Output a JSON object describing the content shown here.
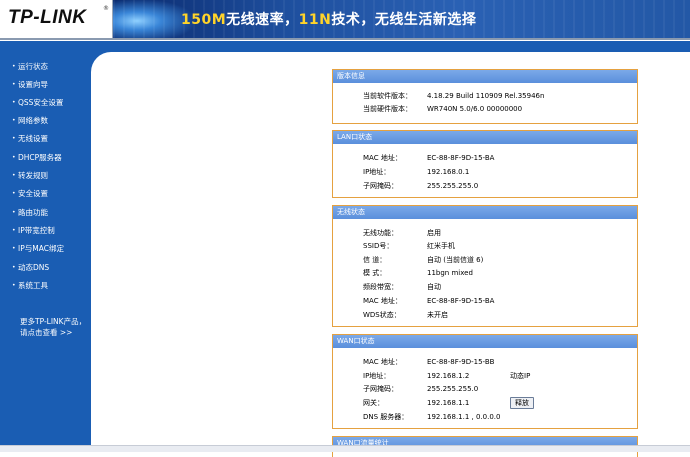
{
  "header": {
    "logo": "TP-LINK",
    "logo_mark": "®",
    "banner_prefix": "150M",
    "banner_mid1": "无线速率，",
    "banner_hl2": "11N",
    "banner_mid2": "技术，无线生活新选择"
  },
  "sidebar": {
    "items": [
      {
        "label": "运行状态"
      },
      {
        "label": "设置向导"
      },
      {
        "label": "QSS安全设置"
      },
      {
        "label": "网络参数"
      },
      {
        "label": "无线设置"
      },
      {
        "label": "DHCP服务器"
      },
      {
        "label": "转发规则"
      },
      {
        "label": "安全设置"
      },
      {
        "label": "路由功能"
      },
      {
        "label": "IP带宽控制"
      },
      {
        "label": "IP与MAC绑定"
      },
      {
        "label": "动态DNS"
      },
      {
        "label": "系统工具"
      }
    ],
    "bullet": "•",
    "more_line1": "更多TP-LINK产品，",
    "more_line2": "请点击查看 >>"
  },
  "version_panel": {
    "title": "版本信息",
    "rows": [
      {
        "label": "当前软件版本：",
        "value": "4.18.29 Build 110909 Rel.35946n"
      },
      {
        "label": "当前硬件版本：",
        "value": "WR740N 5.0/6.0 00000000"
      }
    ]
  },
  "lan_panel": {
    "title": "LAN口状态",
    "rows": [
      {
        "label": "MAC 地址：",
        "value": "EC-88-8F-9D-15-BA"
      },
      {
        "label": "IP地址：",
        "value": "192.168.0.1"
      },
      {
        "label": "子网掩码：",
        "value": "255.255.255.0"
      }
    ]
  },
  "wireless_panel": {
    "title": "无线状态",
    "rows": [
      {
        "label": "无线功能：",
        "value": "启用"
      },
      {
        "label": "SSID号：",
        "value": "红米手机"
      },
      {
        "label": "信 道：",
        "value": "自动 (当前信道 6)"
      },
      {
        "label": "模 式：",
        "value": "11bgn mixed"
      },
      {
        "label": "频段带宽：",
        "value": "自动"
      },
      {
        "label": "MAC 地址：",
        "value": "EC-88-8F-9D-15-BA"
      },
      {
        "label": "WDS状态：",
        "value": "未开启"
      }
    ]
  },
  "wan_panel": {
    "title": "WAN口状态",
    "rows": [
      {
        "label": "MAC 地址：",
        "value": "EC-88-8F-9D-15-BB"
      },
      {
        "label": "IP地址：",
        "value": "192.168.1.2",
        "extra": "动态IP"
      },
      {
        "label": "子网掩码：",
        "value": "255.255.255.0"
      },
      {
        "label": "网关：",
        "value": "192.168.1.1",
        "button": "释放"
      },
      {
        "label": "DNS 服务器：",
        "value": "192.168.1.1 , 0.0.0.0"
      }
    ]
  },
  "traffic_panel": {
    "title": "WAN口流量统计"
  },
  "colors": {
    "sidebar_bg": "#1a5db3",
    "panel_border": "#e5a140",
    "panel_title_bg": "#5a8fdc",
    "banner_highlight": "#ffd42a"
  }
}
